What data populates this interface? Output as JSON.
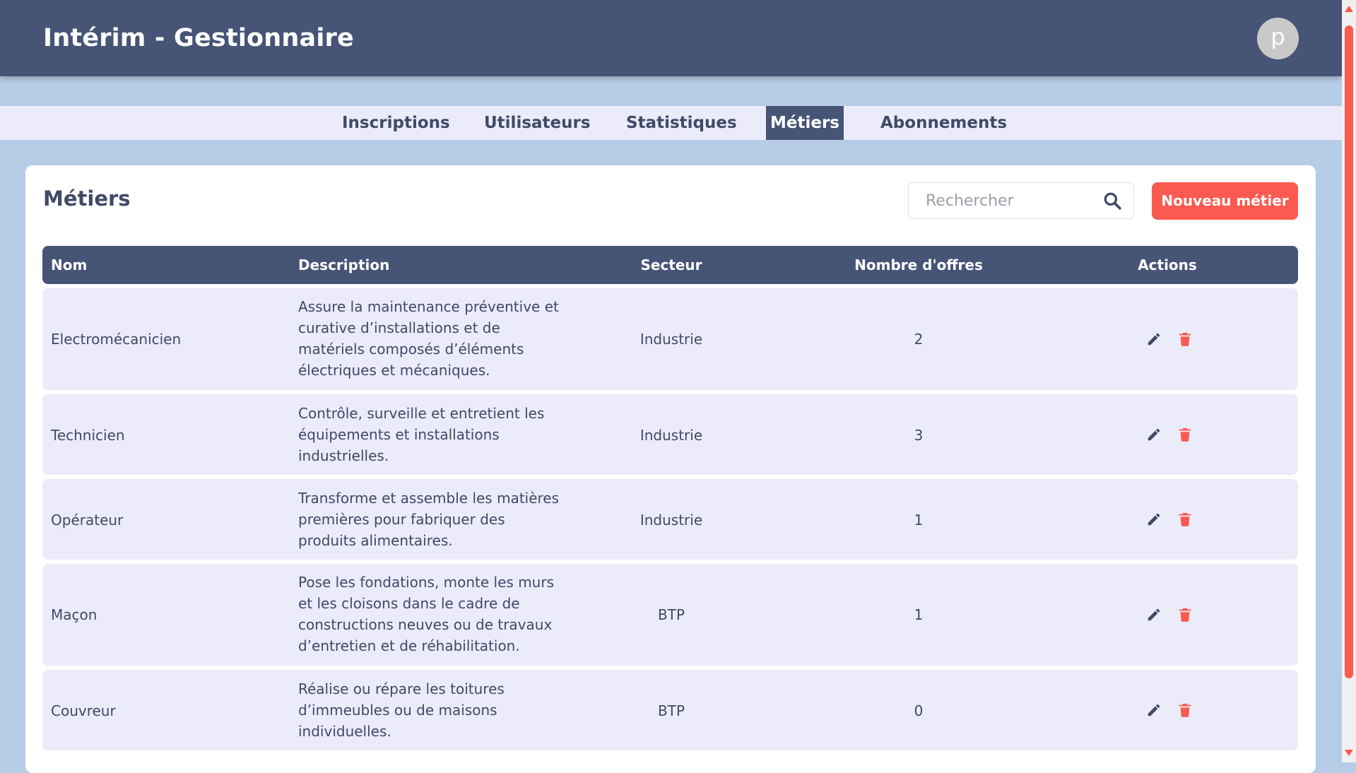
{
  "header": {
    "app_title": "Intérim - Gestionnaire",
    "avatar_letter": "p"
  },
  "nav": {
    "tabs": [
      {
        "label": "Inscriptions",
        "active": false
      },
      {
        "label": "Utilisateurs",
        "active": false
      },
      {
        "label": "Statistiques",
        "active": false
      },
      {
        "label": "Métiers",
        "active": true
      },
      {
        "label": "Abonnements",
        "active": false
      }
    ]
  },
  "main": {
    "title": "Métiers",
    "search": {
      "placeholder": "Rechercher",
      "value": ""
    },
    "new_button_label": "Nouveau métier",
    "table": {
      "columns": [
        "Nom",
        "Description",
        "Secteur",
        "Nombre d'offres",
        "Actions"
      ],
      "rows": [
        {
          "nom": "Electromécanicien",
          "description": "Assure la maintenance préventive et curative d’installations et de matériels composés d’éléments électriques et mécaniques.",
          "secteur": "Industrie",
          "offres": "2"
        },
        {
          "nom": "Technicien",
          "description": "Contrôle, surveille et entretient les équipements et installations industrielles.",
          "secteur": "Industrie",
          "offres": "3"
        },
        {
          "nom": "Opérateur",
          "description": "Transforme et assemble les matières premières pour fabriquer des produits alimentaires.",
          "secteur": "Industrie",
          "offres": "1"
        },
        {
          "nom": "Maçon",
          "description": "Pose les fondations, monte les murs et les cloisons dans le cadre de constructions neuves ou de travaux d’entretien et de réhabilitation.",
          "secteur": "BTP",
          "offres": "1"
        },
        {
          "nom": "Couvreur",
          "description": "Réalise ou répare les toitures d’immeubles ou de maisons individuelles.",
          "secteur": "BTP",
          "offres": "0"
        }
      ]
    }
  },
  "icons": {
    "search": "search-icon",
    "edit": "pencil-icon",
    "delete": "trash-icon"
  },
  "colors": {
    "header_bg": "#465476",
    "page_bg": "#b7cce6",
    "tab_bar_bg": "#ebebfa",
    "accent": "#fa5a50",
    "row_bg": "#ebebfa",
    "text": "#3f4a66"
  }
}
